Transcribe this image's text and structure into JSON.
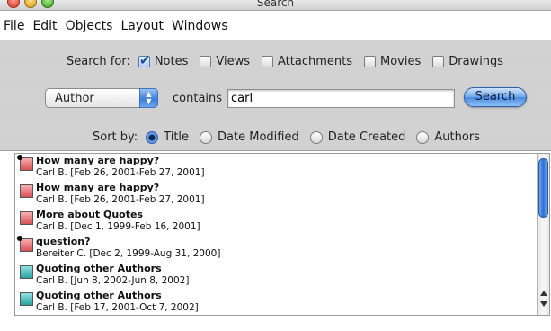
{
  "window": {
    "title": "Search"
  },
  "menu": [
    "File",
    "Edit",
    "Objects",
    "Layout",
    "Windows"
  ],
  "search_for": {
    "label": "Search for:",
    "options": [
      {
        "label": "Notes",
        "checked": true
      },
      {
        "label": "Views",
        "checked": false
      },
      {
        "label": "Attachments",
        "checked": false
      },
      {
        "label": "Movies",
        "checked": false
      },
      {
        "label": "Drawings",
        "checked": false
      }
    ]
  },
  "criteria": {
    "field": "Author",
    "operator": "contains",
    "value": "carl",
    "button_label": "Search"
  },
  "sort": {
    "label": "Sort by:",
    "options": [
      "Title",
      "Date Modified",
      "Date Created",
      "Authors"
    ],
    "selected": "Title"
  },
  "results": [
    {
      "title": "How many are happy?",
      "meta": "Carl B. [Feb 26, 2001-Feb 27, 2001]",
      "color": "pink",
      "icon": "pinned-note-icon"
    },
    {
      "title": "How many are happy?",
      "meta": "Carl B. [Feb 26, 2001-Feb 27, 2001]",
      "color": "pink",
      "icon": "note-icon"
    },
    {
      "title": "More about Quotes",
      "meta": "Carl B. [Dec 1, 1999-Feb 16, 2001]",
      "color": "pink",
      "icon": "note-icon"
    },
    {
      "title": "question?",
      "meta": "Bereiter C. [Dec 2, 1999-Aug 31, 2000]",
      "color": "pink",
      "icon": "pinned-note-icon"
    },
    {
      "title": "Quoting other Authors",
      "meta": "Carl B. [Jun 8, 2002-Jun 8, 2002]",
      "color": "teal",
      "icon": "note-icon"
    },
    {
      "title": "Quoting other Authors",
      "meta": "Carl B. [Feb 17, 2001-Oct 7, 2002]",
      "color": "teal",
      "icon": "note-icon"
    }
  ]
}
